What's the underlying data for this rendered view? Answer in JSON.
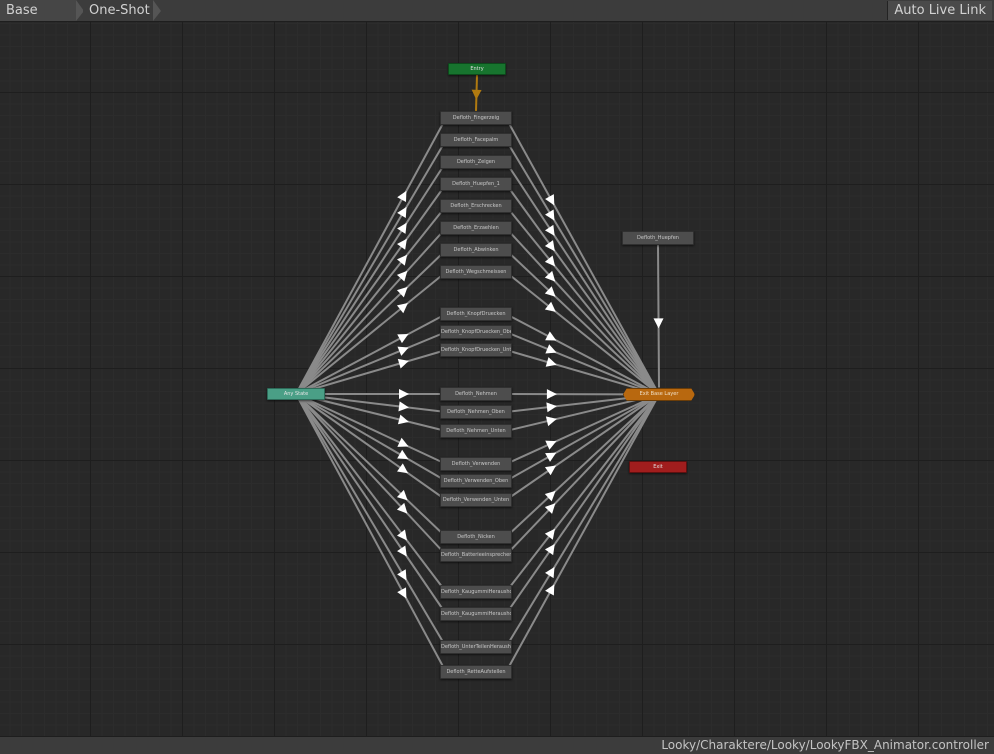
{
  "toolbar": {
    "breadcrumbs": [
      "Base Layer",
      "One-Shot"
    ],
    "live_link_label": "Auto Live Link"
  },
  "graph": {
    "entry": "Entry",
    "any_state": "Any State",
    "exit": "Exit",
    "states": {
      "fingerzeig": "Defloth_Fingerzeig",
      "facepalm": "Defloth_Facepalm",
      "zeigen": "Defloth_Zeigen",
      "huepfen_1": "Defloth_Huepfen_1",
      "erschrecken": "Defloth_Erschrecken",
      "erzaehlen": "Defloth_Erzaehlen",
      "abwinken": "Defloth_Abwinken",
      "wegschmeissen": "Defloth_Wegschmeissen",
      "knopfdruecken": "Defloth_KnopfDruecken",
      "knopfdruecken_oben": "Defloth_KnopfDruecken_Oben",
      "knopfdruecken_unten": "Defloth_KnopfDruecken_Unten",
      "nehmen": "Defloth_Nehmen",
      "nehmen_oben": "Defloth_Nehmen_Oben",
      "nehmen_unten": "Defloth_Nehmen_Unten",
      "verwenden": "Defloth_Verwenden",
      "verwenden_oben": "Defloth_Verwenden_Oben",
      "verwenden_unten": "Defloth_Verwenden_Unten",
      "nicken": "Defloth_Nicken",
      "batterieeinsprechen": "Defloth_Batterieeinsprechen",
      "kaugummiherausholen": "Defloth_KaugummiHerausholen",
      "kaugummiherausholen_oben": "Defloth_KaugummiHerausholen_O",
      "unterteilherausholen": "Defloth_UnterTeilenHerausholen",
      "rettenaufstellen": "Defloth_RetteAufstellen",
      "huepfen": "Defloth_Huepfen",
      "exit_slot": "Exit Base Layer"
    }
  },
  "status": {
    "path": "Looky/Charaktere/Looky/LookyFBX_Animator.controller"
  },
  "colors": {
    "entry": "#17742e",
    "any_state": "#4a9f86",
    "exit": "#a11d1d",
    "slot": "#b8680f",
    "state": "#4d4d4d",
    "transition": "#8a8a8a",
    "entry_transition": "#b07a10"
  }
}
